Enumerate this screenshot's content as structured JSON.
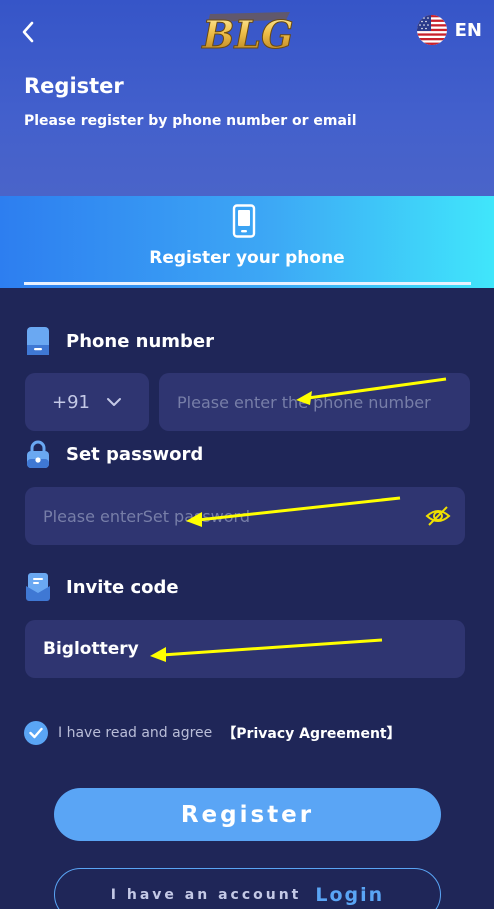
{
  "header": {
    "logo_text": "BLG",
    "language": "EN",
    "title": "Register",
    "subtitle": "Please register by phone number or email"
  },
  "tab": {
    "label": "Register your phone"
  },
  "phone": {
    "label": "Phone number",
    "country_code": "+91",
    "placeholder": "Please enter the phone number",
    "value": ""
  },
  "password": {
    "label": "Set password",
    "placeholder": "Please enterSet password",
    "value": ""
  },
  "invite": {
    "label": "Invite code",
    "value": "Biglottery"
  },
  "agreement": {
    "checked": true,
    "text": "I have read and agree",
    "link": "【Privacy Agreement】"
  },
  "buttons": {
    "register": "Register",
    "have_account": "I have an account",
    "login": "Login"
  },
  "colors": {
    "background": "#1f2658",
    "accent": "#5aa5f5",
    "field_bg": "#2f3571",
    "annotation_arrow": "#ffff00"
  },
  "icons": {
    "back": "chevron-left-icon",
    "flag": "us-flag-icon",
    "tab": "smartphone-icon",
    "phone": "phone-icon",
    "password": "lock-icon",
    "invite": "invite-card-icon",
    "country_dropdown": "chevron-down-icon",
    "eye": "eye-off-icon",
    "check": "check-icon"
  }
}
